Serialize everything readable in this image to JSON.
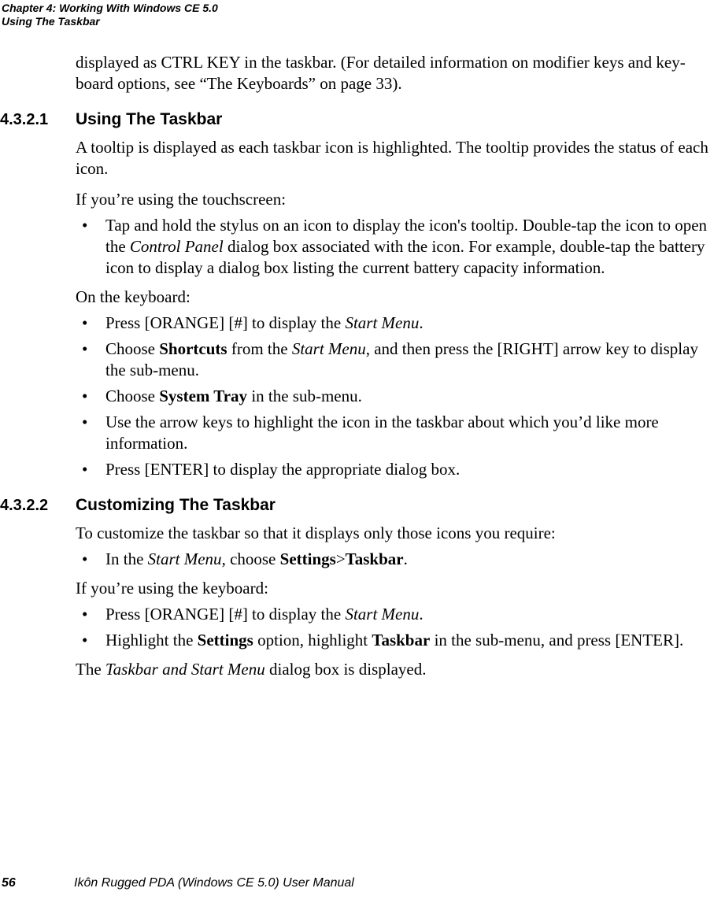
{
  "header": {
    "line1": "Chapter 4:  Working With Windows CE 5.0",
    "line2": "Using The Taskbar"
  },
  "intro": {
    "p1a": "displayed as CTRL KEY in the taskbar. (For detailed information on modifier keys and key-",
    "p1b": "board options, see “The Keyboards” on page 33)."
  },
  "sec1": {
    "num": "4.3.2.1",
    "title": "Using The Taskbar",
    "p1": "A tooltip is displayed as each taskbar icon is highlighted. The tooltip provides the status of each icon.",
    "p2": "If you’re using the touchscreen:",
    "b1_a": "Tap and hold the stylus on an icon to display the icon's tooltip. Double-tap the icon to open the ",
    "b1_i": "Control Panel",
    "b1_b": " dialog box associated with the icon. For example, double-tap the battery icon to display a dialog box listing the current battery capacity information.",
    "p3": "On the keyboard:",
    "b2_a": "Press [ORANGE] [#] to display the ",
    "b2_i": "Start Menu",
    "b2_b": ".",
    "b3_a": "Choose ",
    "b3_bold": "Shortcuts",
    "b3_b": " from the ",
    "b3_i": "Start Menu",
    "b3_c": ", and then press the [RIGHT] arrow key to display the sub-menu.",
    "b4_a": "Choose ",
    "b4_bold": "System Tray",
    "b4_b": " in the sub-menu.",
    "b5": "Use the arrow keys to highlight the icon in the taskbar about which you’d like more information.",
    "b6": "Press [ENTER] to display the appropriate dialog box."
  },
  "sec2": {
    "num": "4.3.2.2",
    "title": "Customizing The Taskbar",
    "p1": "To customize the taskbar so that it displays only those icons you require:",
    "b1_a": "In the ",
    "b1_i": "Start Menu",
    "b1_b": ", choose ",
    "b1_bold1": "Settings",
    "b1_gt": ">",
    "b1_bold2": "Taskbar",
    "b1_c": ".",
    "p2": "If you’re using the keyboard:",
    "b2_a": "Press [ORANGE] [#] to display the ",
    "b2_i": "Start Menu",
    "b2_b": ".",
    "b3_a": "Highlight the ",
    "b3_bold1": "Settings",
    "b3_b": " option, highlight ",
    "b3_bold2": "Taskbar",
    "b3_c": " in the sub-menu, and press [ENTER].",
    "p3_a": "The ",
    "p3_i": "Taskbar and Start Menu",
    "p3_b": " dialog box is displayed."
  },
  "footer": {
    "page": "56",
    "title": "Ikôn Rugged PDA (Windows CE 5.0) User Manual"
  }
}
